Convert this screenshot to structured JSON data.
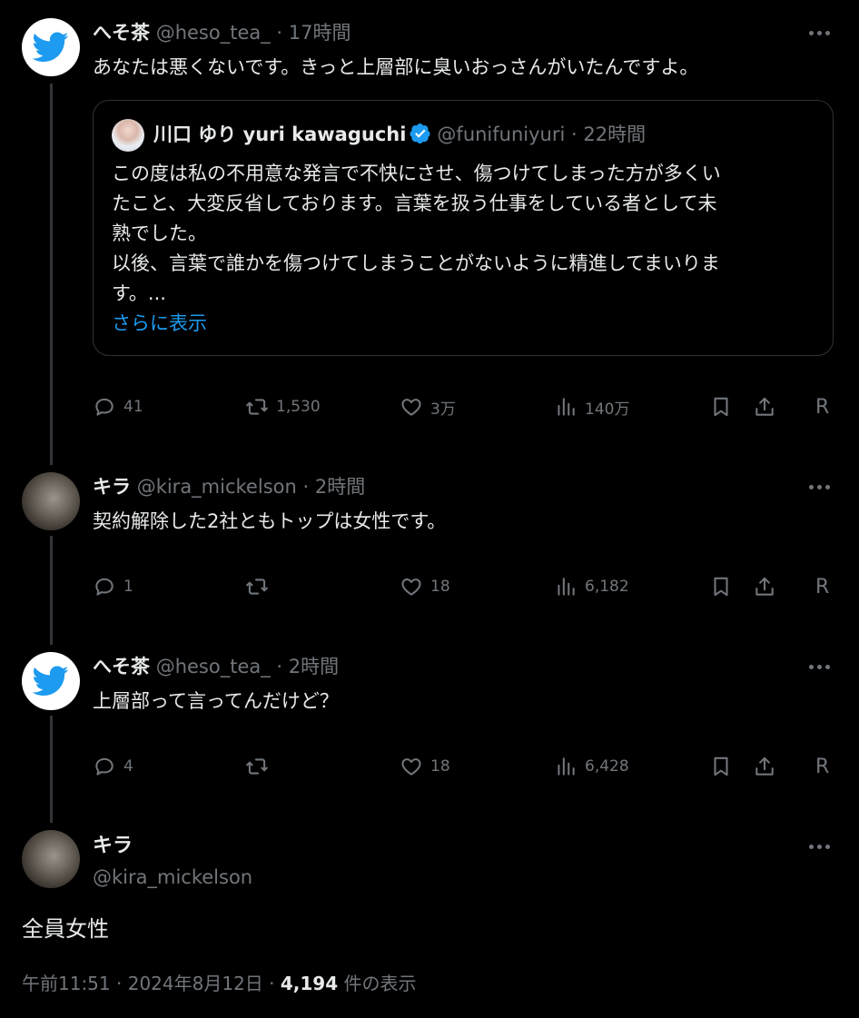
{
  "thread": {
    "tweets": [
      {
        "name": "へそ茶",
        "handle": "@heso_tea_",
        "sep": "·",
        "time": "17時間",
        "text": "あなたは悪くないです。きっと上層部に臭いおっさんがいたんですよ。",
        "quote": {
          "name": "川口 ゆり yuri kawaguchi",
          "handle": "@funifuniyuri",
          "sep": "·",
          "time": "22時間",
          "lines": [
            "この度は私の不用意な発言で不快にさせ、傷つけてしまった方が多くい",
            "たこと、大変反省しております。言葉を扱う仕事をしている者として未",
            "熟でした。",
            "以後、言葉で誰かを傷つけてしまうことがないように精進してまいりま",
            "す。..."
          ],
          "show_more": "さらに表示"
        },
        "replies": "41",
        "reposts": "1,530",
        "likes": "3万",
        "views": "140万",
        "r_label": "R"
      },
      {
        "name": "キラ",
        "handle": "@kira_mickelson",
        "sep": "·",
        "time": "2時間",
        "text": "契約解除した2社ともトップは女性です。",
        "replies": "1",
        "reposts": "",
        "likes": "18",
        "views": "6,182",
        "r_label": "R"
      },
      {
        "name": "へそ茶",
        "handle": "@heso_tea_",
        "sep": "·",
        "time": "2時間",
        "text": "上層部って言ってんだけど？",
        "replies": "4",
        "reposts": "",
        "likes": "18",
        "views": "6,428",
        "r_label": "R"
      }
    ]
  },
  "main_tweet": {
    "name": "キラ",
    "handle": "@kira_mickelson",
    "text": "全員女性",
    "time": "午前11:51",
    "sep": "·",
    "date": "2024年8月12日",
    "sep2": "·",
    "views": "4,194",
    "views_label": "件の表示"
  },
  "icons": {
    "more": "more-dots-icon",
    "reply": "reply-bubble-icon",
    "repost": "repost-arrows-icon",
    "like": "heart-icon",
    "views": "bar-chart-icon",
    "bookmark": "bookmark-icon",
    "share": "share-upload-icon",
    "verified": "verified-badge-icon",
    "bird": "bird-logo-icon"
  },
  "colors": {
    "background": "#000000",
    "text": "#e7e9ea",
    "muted": "#71767b",
    "link": "#1d9bf0",
    "verified": "#1d9bf0",
    "bird": "#1d9bf0"
  }
}
